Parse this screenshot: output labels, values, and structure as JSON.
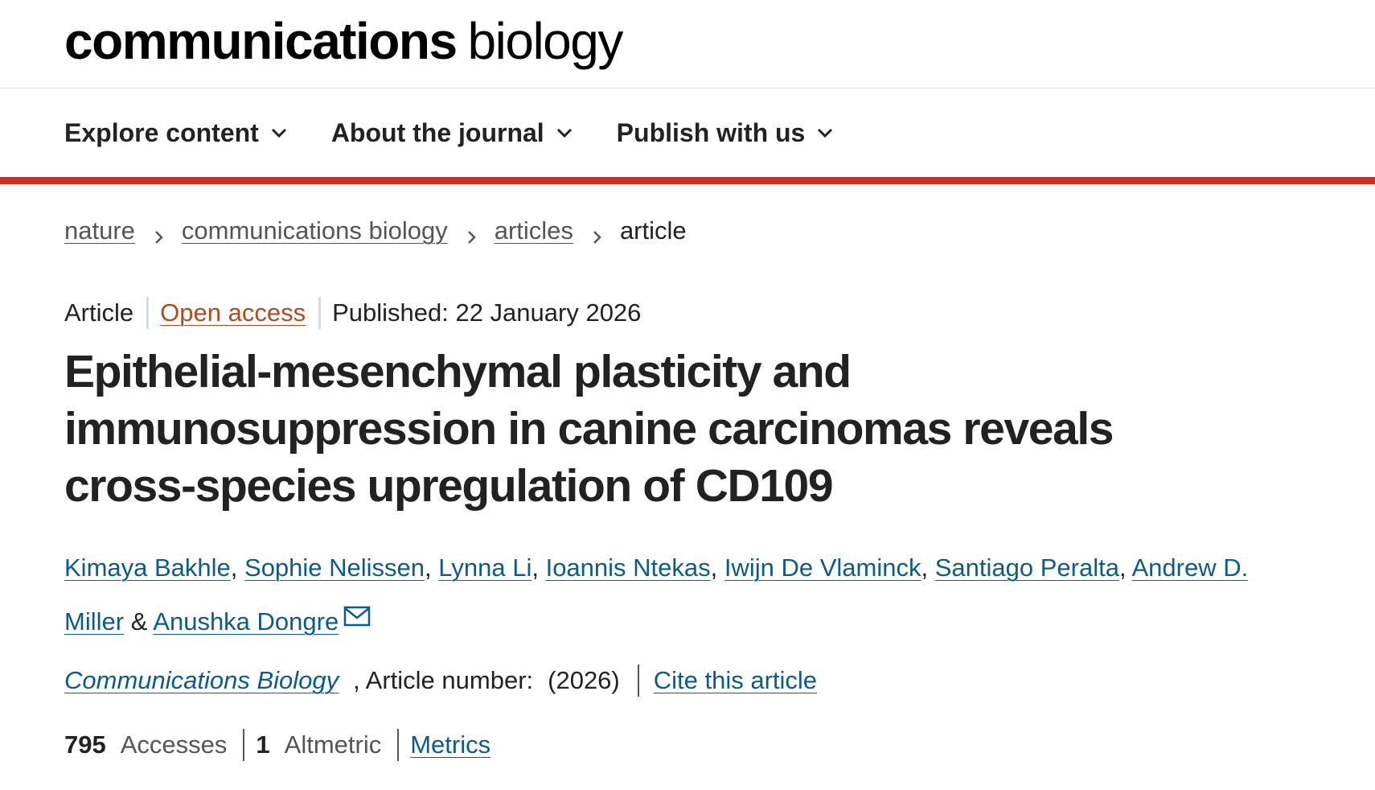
{
  "header": {
    "logo_strong": "communications",
    "logo_light": "biology"
  },
  "nav": {
    "items": [
      {
        "label": "Explore content",
        "icon": "chevron-down-icon"
      },
      {
        "label": "About the journal",
        "icon": "chevron-down-icon"
      },
      {
        "label": "Publish with us",
        "icon": "chevron-down-icon"
      }
    ],
    "accent_color": "#c72f25"
  },
  "breadcrumb": {
    "items": [
      "nature",
      "communications biology",
      "articles"
    ],
    "current": "article",
    "separator_icon": "chevron-right-icon"
  },
  "article": {
    "type": "Article",
    "access": "Open access",
    "published": "Published: 22 January 2026",
    "title": "Epithelial-mesenchymal plasticity and immunosuppression in canine carcinomas reveals cross-species upregulation of CD109",
    "authors": [
      "Kimaya Bakhle",
      "Sophie Nelissen",
      "Lynna Li",
      "Ioannis Ntekas",
      "Iwijn De Vlaminck",
      "Santiago Peralta",
      "Andrew D. Miller"
    ],
    "last_author": "Anushka Dongre",
    "author_joiner": "&",
    "email_icon": "mail-icon",
    "journal": "Communications Biology",
    "article_number_label": ", Article number:",
    "year": "(2026)",
    "cite_label": "Cite this article"
  },
  "metrics": {
    "accesses_value": "795",
    "accesses_label": "Accesses",
    "altmetric_value": "1",
    "altmetric_label": "Altmetric",
    "metrics_link": "Metrics"
  },
  "colors": {
    "link": "#0d5a8c",
    "open_access": "#b24b1b",
    "text": "#222222"
  }
}
